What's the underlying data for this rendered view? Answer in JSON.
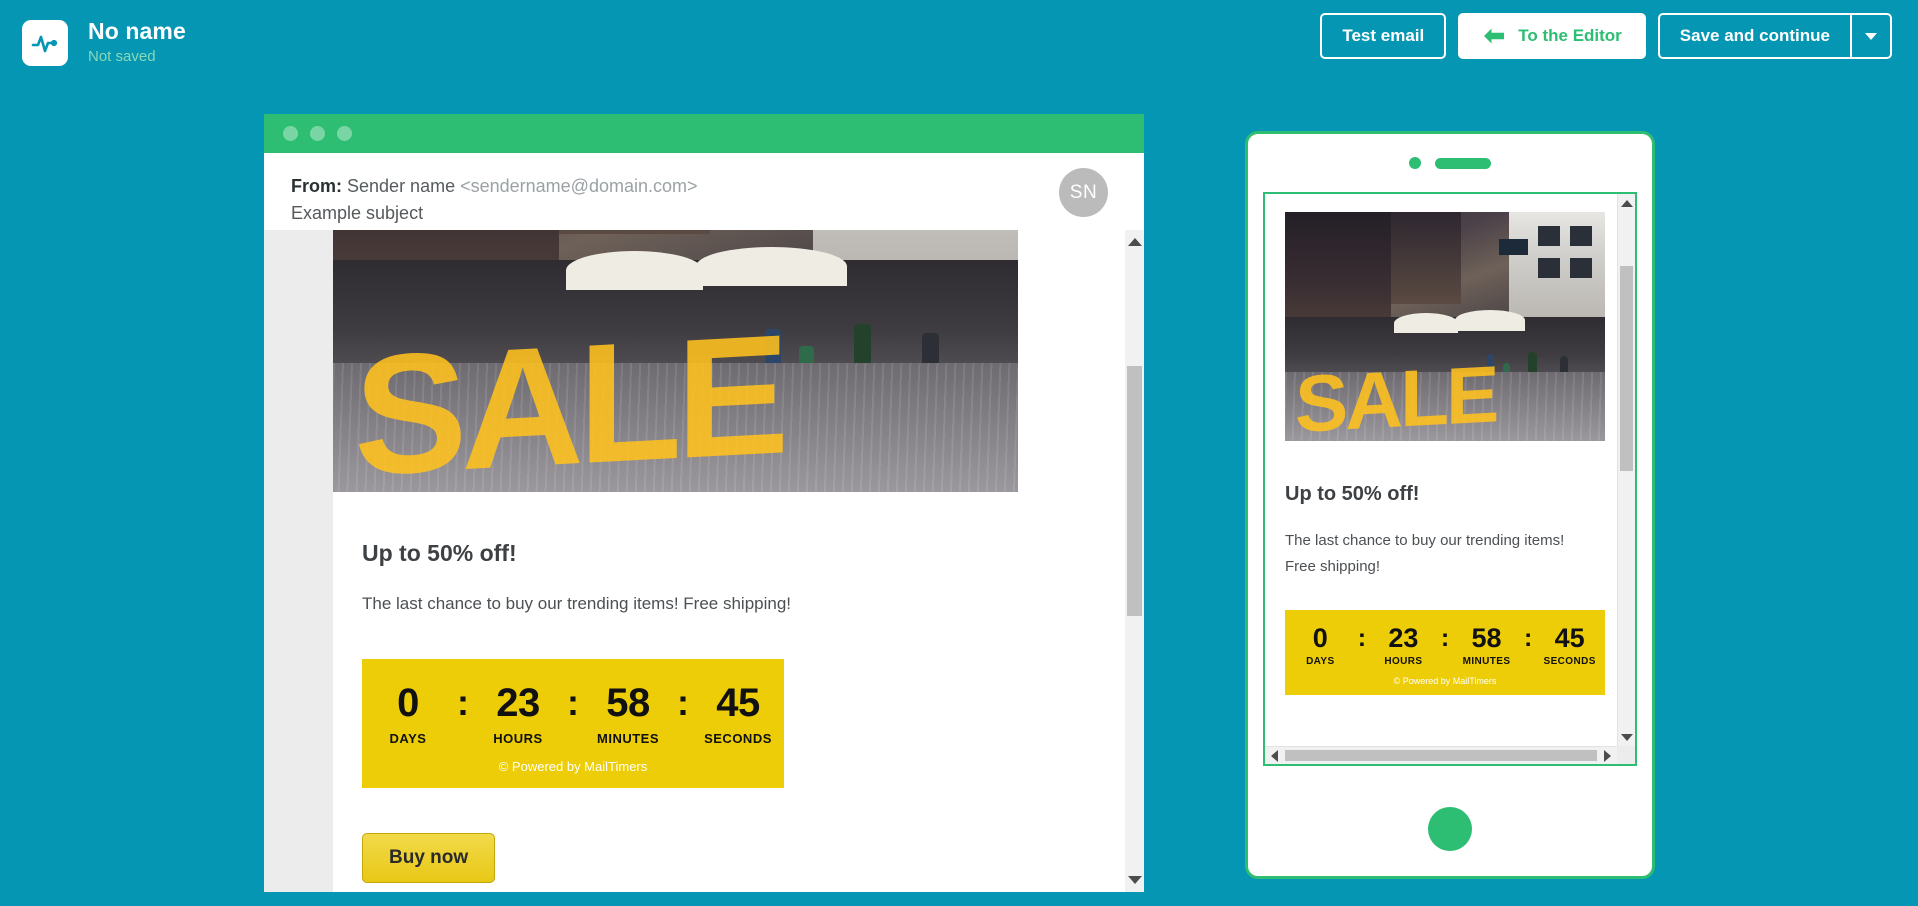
{
  "topbar": {
    "logo_icon": "pulse-logo-icon",
    "title": "No name",
    "status": "Not saved",
    "buttons": {
      "test_email": "Test email",
      "to_the_editor": "To the Editor",
      "save_and_continue": "Save and continue",
      "dropdown_icon": "chevron-down-icon"
    },
    "colors": {
      "background": "#0596b4",
      "accent_green": "#2dbd73",
      "status_text": "#89d9b6"
    }
  },
  "desktop_preview": {
    "titlebar": {
      "dots": 3,
      "color": "#2dbd73"
    },
    "from_label": "From:",
    "sender_name": "Sender name",
    "sender_email": "<sendername@domain.com>",
    "subject": "Example subject",
    "avatar_initials": "SN",
    "scrollbar": {
      "up_icon": "scroll-up-arrow-icon",
      "down_icon": "scroll-down-arrow-icon"
    }
  },
  "email": {
    "hero_image_alt": "SALE storefront window street photo",
    "heading": "Up to 50% off!",
    "paragraph": "The last chance to buy our trending items! Free shipping!",
    "cta": "Buy now",
    "countdown": {
      "background": "#edcd08",
      "units": [
        {
          "value": "0",
          "label": "DAYS"
        },
        {
          "value": "23",
          "label": "HOURS"
        },
        {
          "value": "58",
          "label": "MINUTES"
        },
        {
          "value": "45",
          "label": "SECONDS"
        }
      ],
      "separator": ":",
      "credit": "© Powered by MailTimers"
    }
  },
  "email_mobile": {
    "heading": "Up to 50% off!",
    "paragraph_line1": "The last chance to buy our trending items!",
    "paragraph_line2": "Free shipping!",
    "countdown": {
      "units": [
        {
          "value": "0",
          "label": "DAYS"
        },
        {
          "value": "23",
          "label": "HOURS"
        },
        {
          "value": "58",
          "label": "MINUTES"
        },
        {
          "value": "45",
          "label": "SECONDS"
        }
      ],
      "separator": ":",
      "credit": "© Powered by MailTimers"
    }
  },
  "mobile_preview": {
    "camera_icon": "camera-dot-icon",
    "speaker_icon": "speaker-grill-icon",
    "home_button_icon": "home-button-icon",
    "scrollbar": {
      "up_icon": "scroll-up-arrow-icon",
      "down_icon": "scroll-down-arrow-icon",
      "left_icon": "scroll-left-arrow-icon",
      "right_icon": "scroll-right-arrow-icon"
    }
  },
  "sale_word": "SALE"
}
